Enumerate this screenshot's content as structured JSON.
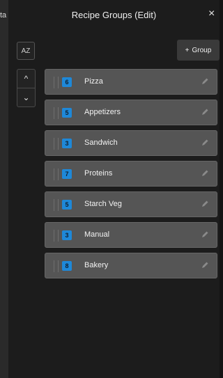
{
  "backdrop": {
    "partial_text": "ta"
  },
  "header": {
    "title": "Recipe Groups (Edit)",
    "close_icon": "close-icon",
    "close_glyph": "×"
  },
  "toolbar": {
    "sort_label": "AZ",
    "move_up_icon": "chevron-up-icon",
    "move_up_glyph": "^",
    "move_down_icon": "chevron-down-icon",
    "move_down_glyph": "⌄",
    "add_group_plus": "+",
    "add_group_label": "Group"
  },
  "groups": [
    {
      "count": "6",
      "name": "Pizza"
    },
    {
      "count": "5",
      "name": "Appetizers"
    },
    {
      "count": "3",
      "name": "Sandwich"
    },
    {
      "count": "7",
      "name": "Proteins"
    },
    {
      "count": "5",
      "name": "Starch Veg"
    },
    {
      "count": "3",
      "name": "Manual"
    },
    {
      "count": "8",
      "name": "Bakery"
    }
  ],
  "colors": {
    "badge": "#1e88d8",
    "row": "#555555",
    "panel": "#1c1c1c",
    "page": "#141414"
  }
}
